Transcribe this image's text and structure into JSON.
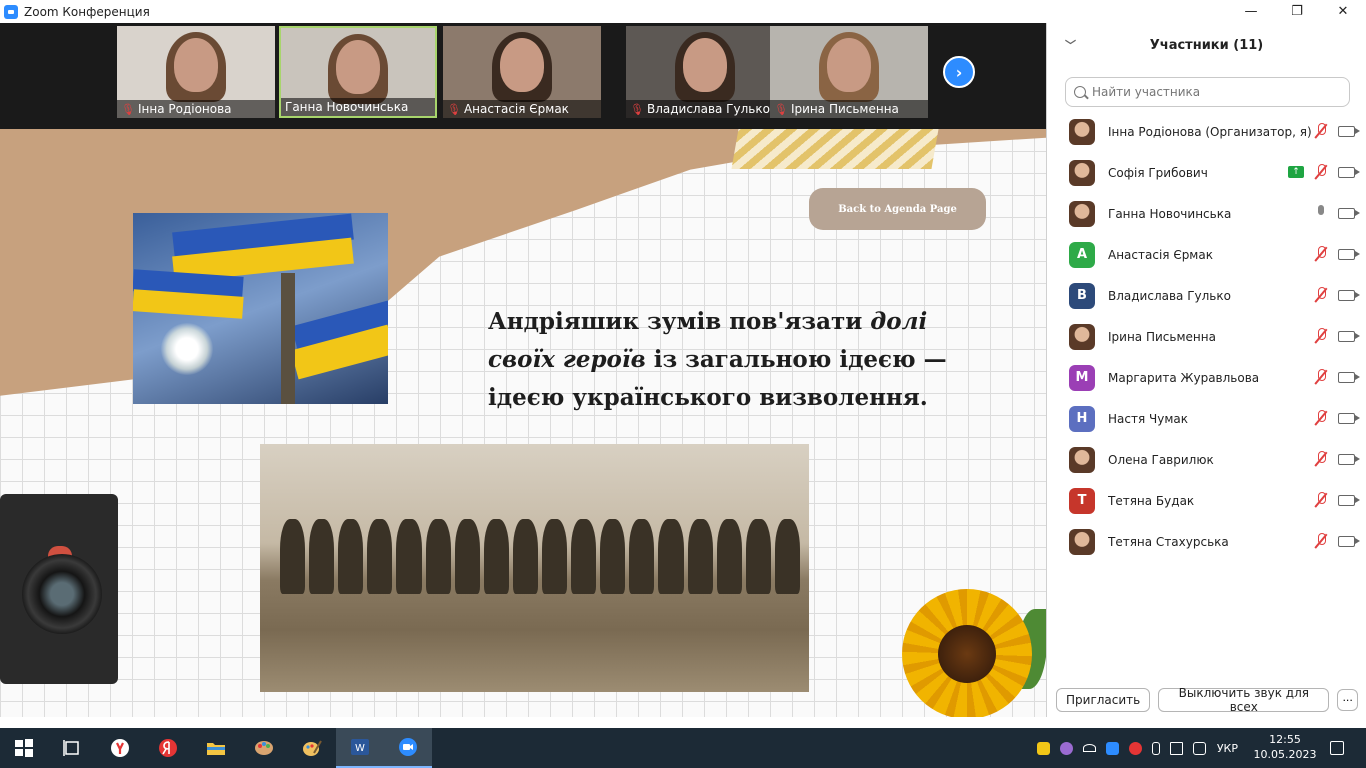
{
  "window": {
    "title": "Zoom Конференция",
    "minimize": "—",
    "maximize": "❐",
    "close": "✕"
  },
  "video_strip": {
    "thumbnails": [
      {
        "name": "Інна Родіонова",
        "muted": true,
        "bg": "#d9d3cc"
      },
      {
        "name": "Ганна Новочинська",
        "muted": false,
        "bg": "#c9c4bc"
      },
      {
        "name": "Анастасія Єрмак",
        "muted": true,
        "bg": "#8c7a6c"
      },
      {
        "name": "Владислава Гулько",
        "muted": true,
        "bg": "#5d5854"
      },
      {
        "name": "Ірина Письменна",
        "muted": true,
        "bg": "#b7b4ae"
      }
    ],
    "next_icon": "›"
  },
  "slide": {
    "agenda_button": "Back to Agenda Page",
    "quote_part1": "Андріяшик зумів пов'язати ",
    "quote_italic": "долі своїх героїв",
    "quote_part2": " із загальною ідеєю — ідеєю українського визволення."
  },
  "panel": {
    "title": "Участники (11)",
    "search_placeholder": "Найти участника",
    "participants": [
      {
        "name": "Інна Родіонова (Организатор, я)",
        "avatar": "photo",
        "letter": "",
        "color": "",
        "mic": "off",
        "share": false
      },
      {
        "name": "Софія Грибович",
        "avatar": "photo",
        "letter": "",
        "color": "",
        "mic": "off",
        "share": true
      },
      {
        "name": "Ганна Новочинська",
        "avatar": "photo",
        "letter": "",
        "color": "",
        "mic": "on",
        "share": false
      },
      {
        "name": "Анастасія Єрмак",
        "avatar": "letter",
        "letter": "А",
        "color": "#2eaa48",
        "mic": "off",
        "share": false
      },
      {
        "name": "Владислава Гулько",
        "avatar": "letter",
        "letter": "В",
        "color": "#2d4a7a",
        "mic": "off",
        "share": false
      },
      {
        "name": "Ірина Письменна",
        "avatar": "photo",
        "letter": "",
        "color": "",
        "mic": "off",
        "share": false
      },
      {
        "name": "Маргарита Журавльова",
        "avatar": "letter",
        "letter": "М",
        "color": "#9b3fb5",
        "mic": "off",
        "share": false
      },
      {
        "name": "Настя Чумак",
        "avatar": "letter",
        "letter": "Н",
        "color": "#5c6fc0",
        "mic": "off",
        "share": false
      },
      {
        "name": "Олена Гаврилюк",
        "avatar": "photo",
        "letter": "",
        "color": "",
        "mic": "off",
        "share": false
      },
      {
        "name": "Тетяна Будак",
        "avatar": "letter",
        "letter": "Т",
        "color": "#c6362b",
        "mic": "off",
        "share": false
      },
      {
        "name": "Тетяна Стахурська",
        "avatar": "photo",
        "letter": "",
        "color": "",
        "mic": "off",
        "share": false
      }
    ],
    "share_icon": "↑",
    "invite_button": "Пригласить",
    "mute_all_button": "Выключить звук для всех",
    "more_button": "···"
  },
  "taskbar": {
    "lang": "УКР",
    "time": "12:55",
    "date": "10.05.2023"
  },
  "colors": {
    "zoom_blue": "#2d8cff",
    "taskbar_bg": "#1c2a36",
    "mute_red": "#e04040"
  }
}
